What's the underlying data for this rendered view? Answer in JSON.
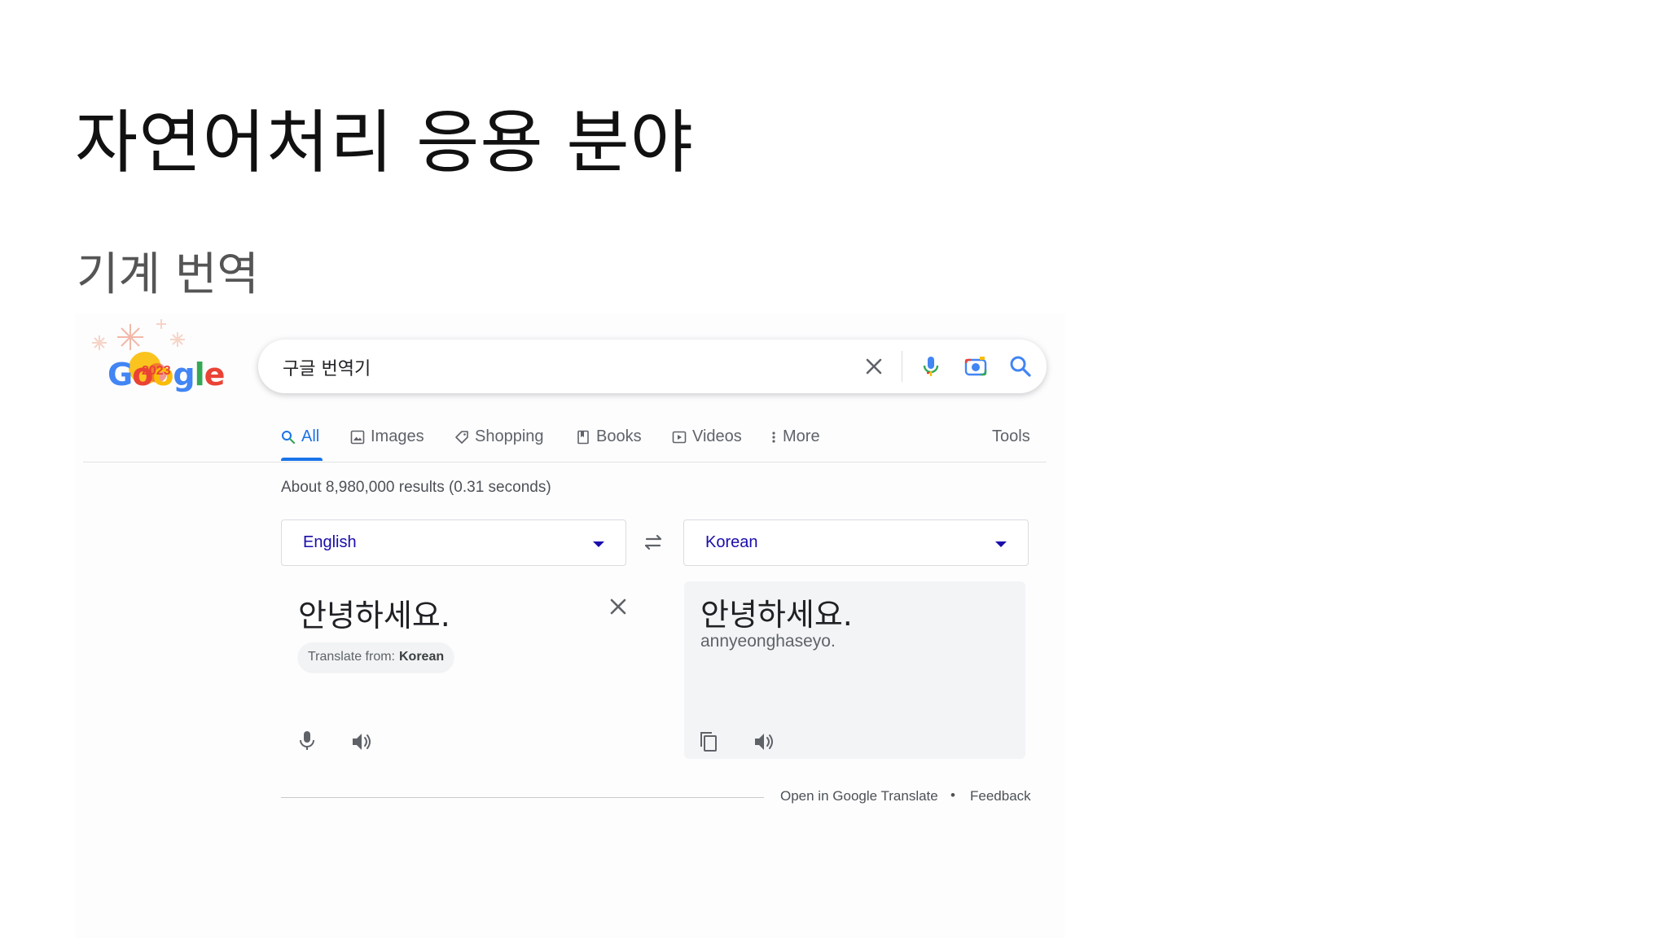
{
  "slide": {
    "title": "자연어처리 응용 분야",
    "subtitle": "기계 번역"
  },
  "logo": {
    "text": "Google",
    "doodle_year": "2023",
    "icon": "google-doodle-logo"
  },
  "search": {
    "query": "구글 번역기",
    "icons": [
      "close-icon",
      "microphone-icon",
      "camera-icon",
      "search-icon"
    ]
  },
  "tabs": [
    {
      "label": "All",
      "icon": "search-icon",
      "active": true
    },
    {
      "label": "Images",
      "icon": "image-icon"
    },
    {
      "label": "Shopping",
      "icon": "tag-icon"
    },
    {
      "label": "Books",
      "icon": "book-icon"
    },
    {
      "label": "Videos",
      "icon": "video-icon"
    },
    {
      "label": "More",
      "icon": "more-vert-icon"
    }
  ],
  "tools_label": "Tools",
  "results_stats": "About 8,980,000 results (0.31 seconds)",
  "translate": {
    "source_lang": "English",
    "target_lang": "Korean",
    "source_text": "안녕하세요.",
    "target_text": "안녕하세요.",
    "romanization": "annyeonghaseyo.",
    "suggest_prefix": "Translate from:",
    "suggest_lang": "Korean"
  },
  "footer": {
    "open_link": "Open in Google Translate",
    "separator": "•",
    "feedback_link": "Feedback"
  },
  "colors": {
    "accent_blue": "#1a73e8",
    "link_blue": "#1a0dab",
    "text_gray": "#5f6368"
  }
}
